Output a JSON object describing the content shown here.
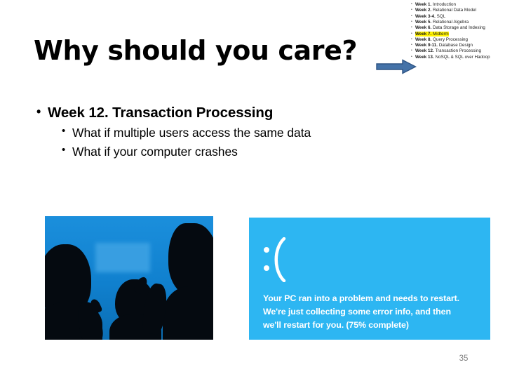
{
  "slide": {
    "title": "Why should you care?",
    "page_number": "35",
    "arrow": {
      "icon": "right-arrow-icon",
      "fill_color": "#4472A8",
      "stroke_color": "#2E5484"
    }
  },
  "syllabus": {
    "items": [
      {
        "week": "Week 1.",
        "topic": "Introduction",
        "highlighted": false
      },
      {
        "week": "Week 2.",
        "topic": "Relational Data Model",
        "highlighted": false
      },
      {
        "week": "Week 3-4.",
        "topic": "SQL",
        "highlighted": false
      },
      {
        "week": "Week 5.",
        "topic": "Relational Algebra",
        "highlighted": false
      },
      {
        "week": "Week 6.",
        "topic": "Data Storage and Indexing",
        "highlighted": false
      },
      {
        "week": "Week 7.",
        "topic": "Midterm",
        "highlighted": true
      },
      {
        "week": "Week 8.",
        "topic": "Query Processing",
        "highlighted": false
      },
      {
        "week": "Week 9-11.",
        "topic": "Database Design",
        "highlighted": false
      },
      {
        "week": "Week 12.",
        "topic": "Transaction Processing",
        "highlighted": false
      },
      {
        "week": "Week 13.",
        "topic": "NoSQL & SQL over Hadoop",
        "highlighted": false
      }
    ],
    "bullet_glyph": "•",
    "highlight_color": "#FFF200"
  },
  "body": {
    "bullet_glyph": "•",
    "main": "Week 12. Transaction  Processing",
    "sub": [
      "What  if  multiple  users  access  the  same  data",
      "What  if  your  computer  crashes"
    ]
  },
  "photos": {
    "silhouettes": {
      "caption": "silhouettes-of-people-against-blue-screen",
      "background_color": "#1080CE"
    },
    "bsod": {
      "caption": "windows-blue-screen-of-death",
      "background_color": "#2DB6F2",
      "face": ":(",
      "lines": [
        "Your PC ran into a problem and needs to restart.",
        "We're just collecting some error info, and then",
        "we'll restart for you. (75% complete)"
      ]
    }
  }
}
